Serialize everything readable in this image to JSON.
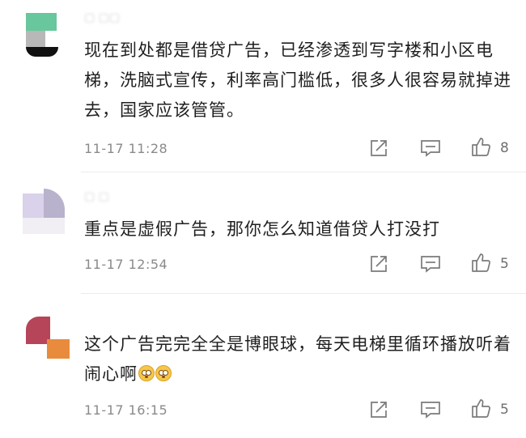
{
  "comments": [
    {
      "text": "现在到处都是借贷广告，已经渗透到写字楼和小区电梯，洗脑式宣传，利率高门槛低，很多人很容易就掉进去，国家应该管管。",
      "time": "11-17 11:28",
      "likes": "8",
      "avatar_colors": [
        "#68c79c",
        "#b8b8b8",
        "#111111"
      ]
    },
    {
      "text": "重点是虚假广告，那你怎么知道借贷人打没打",
      "time": "11-17 12:54",
      "likes": "5",
      "avatar_colors": [
        "#d9d2ea",
        "#b9b2cc",
        "#eeeeee"
      ]
    },
    {
      "text": "这个广告完完全全是博眼球，每天电梯里循环播放听着闹心啊",
      "time": "11-17 16:15",
      "likes": "5",
      "avatar_colors": [
        "#b6455a",
        "#e98b3c"
      ]
    }
  ],
  "icons": {
    "share": "share-icon",
    "reply": "reply-icon",
    "like": "thumbs-up-icon",
    "emoji": "flushed-face-emoji"
  }
}
